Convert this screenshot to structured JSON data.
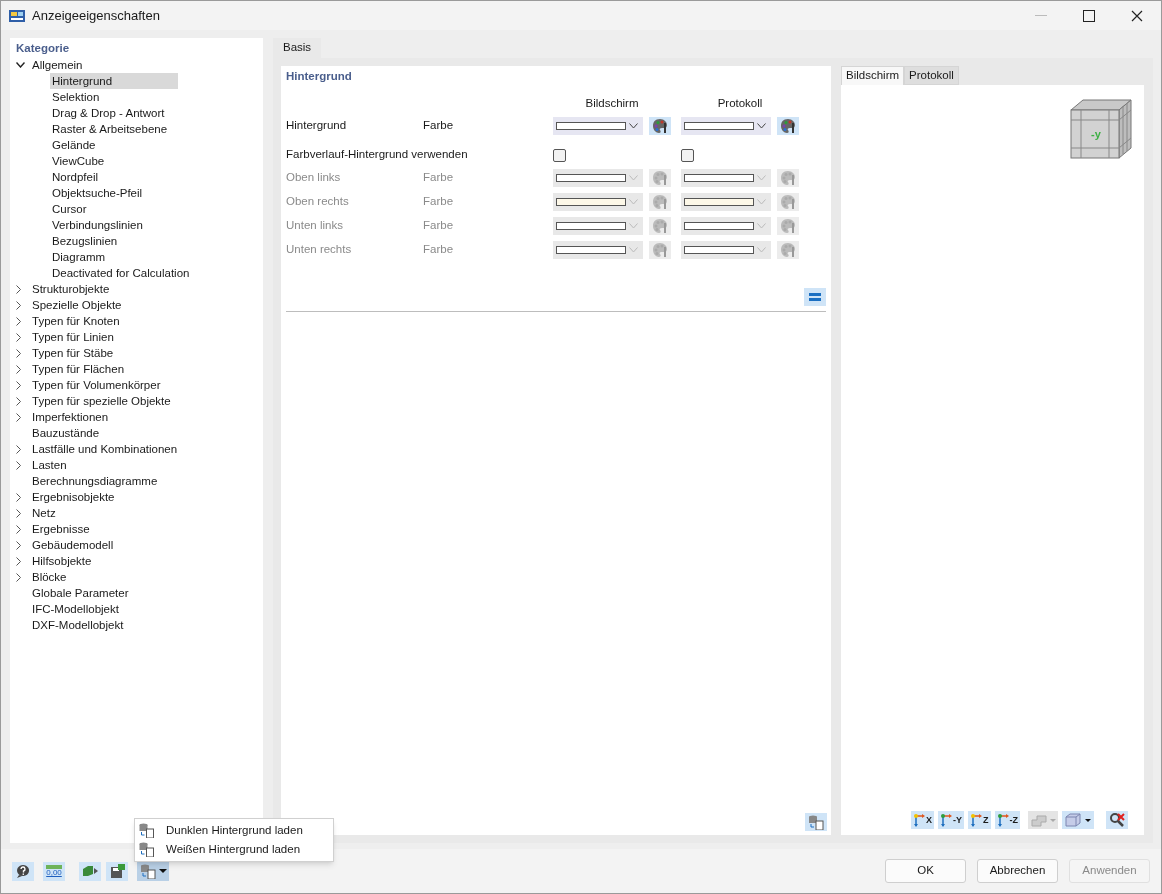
{
  "window": {
    "title": "Anzeigeeigenschaften"
  },
  "sidebar": {
    "title": "Kategorie",
    "items": [
      {
        "label": "Allgemein",
        "kind": "folder",
        "expanded": true,
        "selected": false,
        "children": [
          {
            "label": "Hintergrund",
            "selected": true
          },
          {
            "label": "Selektion",
            "selected": false
          },
          {
            "label": "Drag & Drop - Antwort",
            "selected": false
          },
          {
            "label": "Raster & Arbeitsebene",
            "selected": false
          },
          {
            "label": "Gelände",
            "selected": false
          },
          {
            "label": "ViewCube",
            "selected": false
          },
          {
            "label": "Nordpfeil",
            "selected": false
          },
          {
            "label": "Objektsuche-Pfeil",
            "selected": false
          },
          {
            "label": "Cursor",
            "selected": false
          },
          {
            "label": "Verbindungslinien",
            "selected": false
          },
          {
            "label": "Bezugslinien",
            "selected": false
          },
          {
            "label": "Diagramm",
            "selected": false
          },
          {
            "label": "Deactivated for Calculation",
            "selected": false
          }
        ]
      },
      {
        "label": "Strukturobjekte",
        "kind": "folder",
        "expanded": false,
        "selected": false
      },
      {
        "label": "Spezielle Objekte",
        "kind": "folder",
        "expanded": false,
        "selected": false
      },
      {
        "label": "Typen für Knoten",
        "kind": "folder",
        "expanded": false,
        "selected": false
      },
      {
        "label": "Typen für Linien",
        "kind": "folder",
        "expanded": false,
        "selected": false
      },
      {
        "label": "Typen für Stäbe",
        "kind": "folder",
        "expanded": false,
        "selected": false
      },
      {
        "label": "Typen für Flächen",
        "kind": "folder",
        "expanded": false,
        "selected": false
      },
      {
        "label": "Typen für Volumenkörper",
        "kind": "folder",
        "expanded": false,
        "selected": false
      },
      {
        "label": "Typen für spezielle Objekte",
        "kind": "folder",
        "expanded": false,
        "selected": false
      },
      {
        "label": "Imperfektionen",
        "kind": "folder",
        "expanded": false,
        "selected": false
      },
      {
        "label": "Bauzustände",
        "kind": "leaf",
        "selected": false
      },
      {
        "label": "Lastfälle und Kombinationen",
        "kind": "folder",
        "expanded": false,
        "selected": false
      },
      {
        "label": "Lasten",
        "kind": "folder",
        "expanded": false,
        "selected": false
      },
      {
        "label": "Berechnungsdiagramme",
        "kind": "leaf",
        "selected": false
      },
      {
        "label": "Ergebnisobjekte",
        "kind": "folder",
        "expanded": false,
        "selected": false
      },
      {
        "label": "Netz",
        "kind": "folder",
        "expanded": false,
        "selected": false
      },
      {
        "label": "Ergebnisse",
        "kind": "folder",
        "expanded": false,
        "selected": false
      },
      {
        "label": "Gebäudemodell",
        "kind": "folder",
        "expanded": false,
        "selected": false
      },
      {
        "label": "Hilfsobjekte",
        "kind": "folder",
        "expanded": false,
        "selected": false
      },
      {
        "label": "Blöcke",
        "kind": "folder",
        "expanded": false,
        "selected": false
      },
      {
        "label": "Globale Parameter",
        "kind": "leaf",
        "selected": false
      },
      {
        "label": "IFC-Modellobjekt",
        "kind": "leaf",
        "selected": false
      },
      {
        "label": "DXF-Modellobjekt",
        "kind": "leaf",
        "selected": false
      }
    ]
  },
  "tabs": [
    {
      "label": "Basis",
      "selected": true
    }
  ],
  "section": {
    "title": "Hintergrund",
    "columns": [
      "Bildschirm",
      "Protokoll"
    ],
    "rows": [
      {
        "kind": "color",
        "label": "Hintergrund",
        "type": "Farbe",
        "disabled": false,
        "screen": {
          "color": "#ffffff"
        },
        "protocol": {
          "color": "#ffffff"
        }
      },
      {
        "kind": "checkbox",
        "label": "Farbverlauf-Hintergrund verwenden",
        "screen": {
          "checked": false
        },
        "protocol": {
          "checked": false
        }
      },
      {
        "kind": "color",
        "label": "Oben links",
        "type": "Farbe",
        "disabled": true,
        "screen": {
          "color": "#ffffff"
        },
        "protocol": {
          "color": "#ffffff"
        }
      },
      {
        "kind": "color",
        "label": "Oben rechts",
        "type": "Farbe",
        "disabled": true,
        "screen": {
          "color": "#fdf8e8"
        },
        "protocol": {
          "color": "#fdf8e8"
        }
      },
      {
        "kind": "color",
        "label": "Unten links",
        "type": "Farbe",
        "disabled": true,
        "screen": {
          "color": "#ffffff"
        },
        "protocol": {
          "color": "#ffffff"
        }
      },
      {
        "kind": "color",
        "label": "Unten rechts",
        "type": "Farbe",
        "disabled": true,
        "screen": {
          "color": "#ffffff"
        },
        "protocol": {
          "color": "#ffffff"
        }
      }
    ]
  },
  "preview": {
    "tabs": [
      {
        "label": "Bildschirm",
        "selected": true
      },
      {
        "label": "Protokoll",
        "selected": false
      }
    ],
    "cube_label": "-y",
    "toolbar": [
      {
        "kind": "axis",
        "label": "X"
      },
      {
        "kind": "axis",
        "label": "-Y"
      },
      {
        "kind": "axis",
        "label": "Z"
      },
      {
        "kind": "axis",
        "label": "-Z"
      },
      {
        "kind": "steps",
        "disabled": true
      },
      {
        "kind": "box",
        "disabled": false
      },
      {
        "kind": "reset"
      }
    ]
  },
  "popup_menu": [
    "Dunklen Hintergrund laden",
    "Weißen Hintergrund laden"
  ],
  "bottom_toolbar": [
    {
      "kind": "help"
    },
    {
      "kind": "units",
      "label": "0,00"
    },
    {
      "kind": "export"
    },
    {
      "kind": "save"
    },
    {
      "kind": "load"
    }
  ],
  "buttons": [
    {
      "label": "OK",
      "disabled": false
    },
    {
      "label": "Abbrechen",
      "disabled": false
    },
    {
      "label": "Anwenden",
      "disabled": true
    }
  ]
}
